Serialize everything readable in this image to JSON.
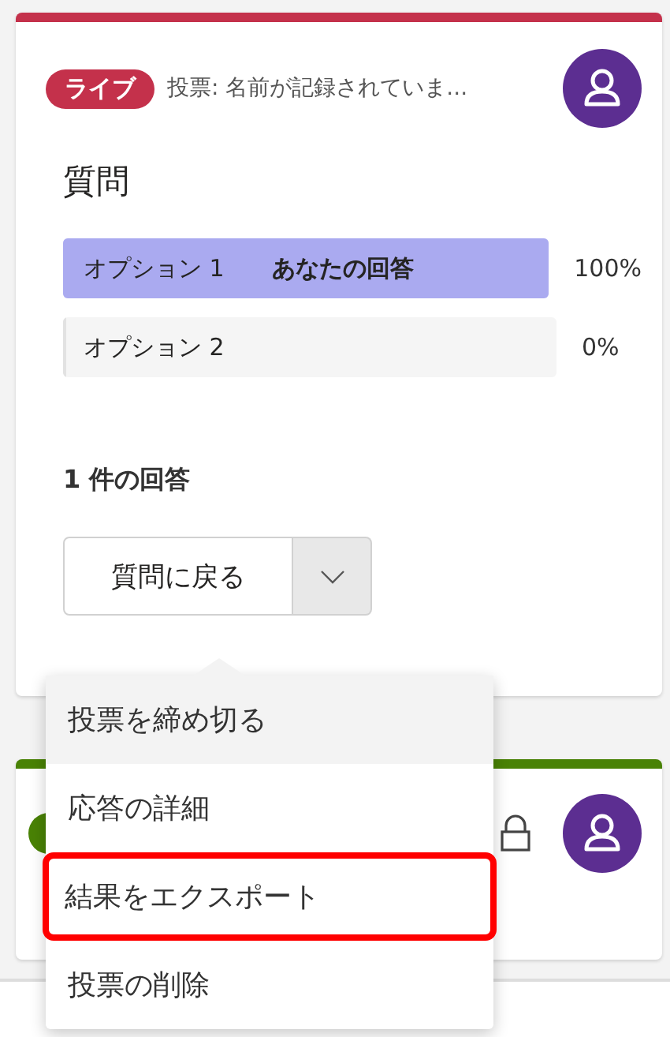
{
  "cards": [
    {
      "color": "#c4314b",
      "badge": {
        "label": "ライブ",
        "color": "#c4314b"
      },
      "title": "投票: 名前が記録されていま...",
      "question": "質問",
      "options": [
        {
          "label": "オプション 1",
          "tag": "あなたの回答",
          "level": 1,
          "percent": "100%",
          "selected": true
        },
        {
          "label": "オプション 2",
          "level": 0,
          "percent": "0%",
          "selected": false
        }
      ],
      "response_count": "1 件の回答",
      "button": "質問に戻る"
    },
    {
      "color": "#498205",
      "badge": {
        "color": "#498205"
      },
      "locked": true
    }
  ],
  "menu": {
    "expanded": true,
    "items": [
      {
        "label": "投票を締め切る",
        "hovered": true,
        "highlighted": false
      },
      {
        "label": "応答の詳細",
        "hovered": false,
        "highlighted": false
      },
      {
        "label": "結果をエクスポート",
        "hovered": false,
        "highlighted": true
      },
      {
        "label": "投票の削除",
        "hovered": false,
        "highlighted": false
      }
    ]
  }
}
